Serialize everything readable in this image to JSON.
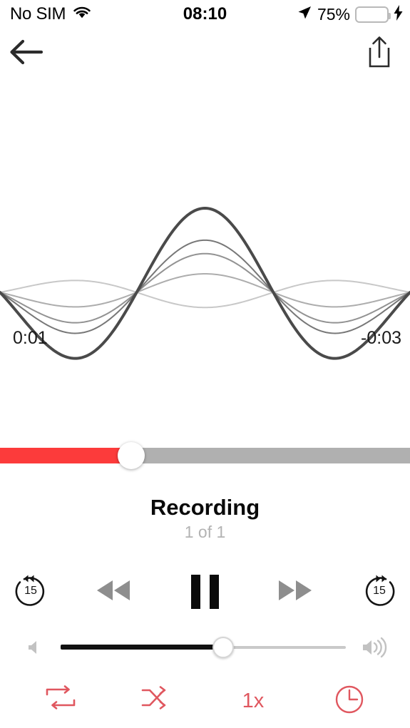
{
  "status_bar": {
    "carrier": "No SIM",
    "wifi_icon": "wifi-icon",
    "time": "08:10",
    "location_icon": "location-arrow-icon",
    "battery_percent": "75%",
    "battery_level": 75,
    "battery_color": "#4CD964",
    "charging_icon": "lightning-bolt-icon"
  },
  "nav": {
    "back_icon": "arrow-left-icon",
    "share_icon": "share-icon"
  },
  "waveform": {
    "current_time": "0:01",
    "remaining_time": "-0:03",
    "curve_color": "#4a4a4a",
    "curves": [
      {
        "amplitude": 1.0,
        "opacity": 1.0,
        "width": 4.0
      },
      {
        "amplitude": 0.62,
        "opacity": 0.75,
        "width": 2.0
      },
      {
        "amplitude": 0.46,
        "opacity": 0.6,
        "width": 2.0
      },
      {
        "amplitude": 0.22,
        "opacity": 0.45,
        "width": 2.0
      },
      {
        "amplitude": -0.18,
        "opacity": 0.3,
        "width": 2.0
      }
    ]
  },
  "scrubber": {
    "progress_percent": 32,
    "fill_color": "#FC3B3B",
    "track_color": "#b0b0b0",
    "thumb_name": "scrubber-thumb"
  },
  "track": {
    "title": "Recording",
    "subtitle": "1 of 1"
  },
  "transport": {
    "skip_back_label": "15",
    "skip_back_icon": "skip-back-15-icon",
    "rewind_icon": "rewind-icon",
    "pause_icon": "pause-icon",
    "fast_forward_icon": "fast-forward-icon",
    "skip_forward_label": "15",
    "skip_forward_icon": "skip-forward-15-icon",
    "gray_color": "#8e8e8e",
    "black_color": "#0b0b0b"
  },
  "volume": {
    "min_icon": "speaker-low-icon",
    "max_icon": "speaker-high-icon",
    "level_percent": 57,
    "fill_color": "#111111",
    "track_color": "#c9c9c9"
  },
  "bottom_bar": {
    "accent_color": "#E0575F",
    "items": [
      {
        "name": "repeat-button",
        "icon": "repeat-icon",
        "label": ""
      },
      {
        "name": "shuffle-button",
        "icon": "shuffle-icon",
        "label": ""
      },
      {
        "name": "playback-speed-button",
        "icon": "speed-text",
        "label": "1x"
      },
      {
        "name": "sleep-timer-button",
        "icon": "clock-icon",
        "label": ""
      }
    ],
    "speed_label": "1x"
  }
}
